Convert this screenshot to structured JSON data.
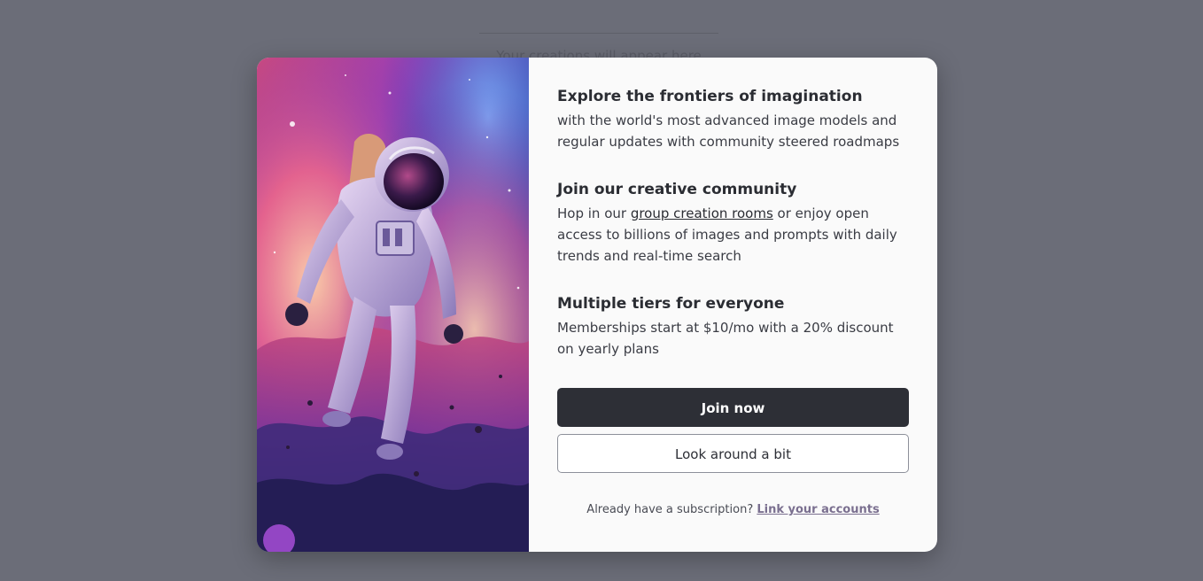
{
  "background": {
    "placeholder_text": "Your creations will appear here"
  },
  "modal": {
    "image_alt": "Astronaut floating in a colorful nebula",
    "features": [
      {
        "title": "Explore the frontiers of imagination",
        "body": "with the world's most advanced image models and regular updates with community steered roadmaps"
      },
      {
        "title": "Join our creative community",
        "body_before": "Hop in our ",
        "link": "group creation rooms",
        "body_after": " or enjoy open access to billions of images and prompts with daily trends and real-time search"
      },
      {
        "title": "Multiple tiers for everyone",
        "body": "Memberships start at $10/mo with a 20% discount on yearly plans"
      }
    ],
    "primary_button": "Join now",
    "secondary_button": "Look around a bit",
    "footer_text": "Already have a subscription? ",
    "footer_link": "Link your accounts"
  },
  "colors": {
    "backdrop": "#6b6d78",
    "modal_bg": "#fafafa",
    "primary": "#2d2f36",
    "link_accent": "#7a6f8f"
  }
}
